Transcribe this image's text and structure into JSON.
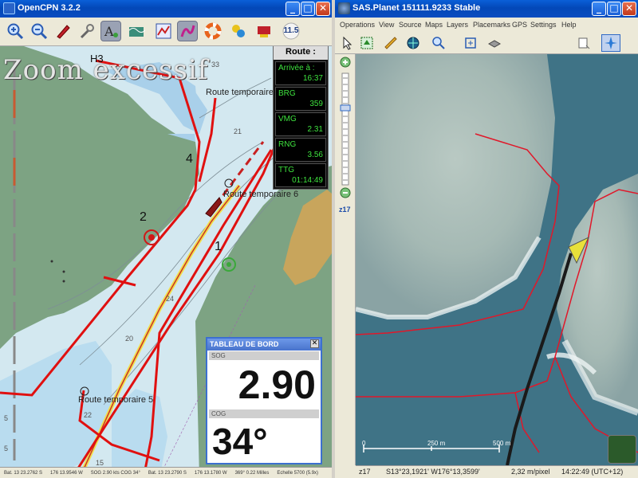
{
  "opencpn": {
    "title": "OpenCPN 3.2.2",
    "toolbar": {
      "tools": [
        "zoom-in",
        "zoom-out",
        "go-to-position",
        "settings",
        "text-anchor",
        "tide-current",
        "routes",
        "track",
        "lifebuoy",
        "plugin-chart",
        "ais",
        "scale"
      ],
      "scale_value": "11.5"
    },
    "chart": {
      "overzoom_text": "Zoom excessif",
      "route_labels": [
        "Route temporaire",
        "Route temporaire 6",
        "Route temporaire 5"
      ],
      "waypoint_numbers": [
        "1",
        "2",
        "4",
        "H3"
      ],
      "depths": [
        "33",
        "21",
        "24",
        "20",
        "22",
        "15",
        "5",
        "5"
      ]
    },
    "route_panel": {
      "title": "Route :",
      "fields": [
        {
          "label": "Arrivée à :",
          "value": "16:37"
        },
        {
          "label": "BRG",
          "value": "359"
        },
        {
          "label": "VMG",
          "value": "2.31"
        },
        {
          "label": "RNG",
          "value": "3.56"
        },
        {
          "label": "TTG",
          "value": "01:14:49"
        }
      ]
    },
    "dashboard": {
      "title": "TABLEAU DE BORD",
      "sog_label": "SOG",
      "sog_value": "2.90",
      "cog_label": "COG",
      "cog_value": "34°"
    },
    "status": [
      "Bat. 13 23.2762 S",
      "176 13.9546 W",
      "SOG 2.90 kts  COG 34°",
      "Bat. 13 23.2790 S",
      "176 13.1780 W",
      "369° 0.22 Milles",
      "Echelle 5700 (5.9x)"
    ]
  },
  "sasplanet": {
    "title": "SAS.Planet 151111.9233 Stable",
    "menu": [
      "Operations",
      "View",
      "Source",
      "Maps",
      "Layers",
      "Placemarks",
      "GPS",
      "Settings",
      "Help"
    ],
    "zoom_label": "z17",
    "scale": {
      "zero": "0",
      "mid": "250 m",
      "end": "500 m"
    },
    "status": {
      "zoom": "z17",
      "coords": "S13°23,1921' W176°13,3599'",
      "resolution": "2,32 m/pixel",
      "time": "14:22:49 (UTC+12)"
    }
  },
  "colors": {
    "route": "#e01010",
    "land": "#7da383",
    "shallow": "#a9d0ea",
    "water": "#d3e8f0",
    "xp_title": "#0a4cc0"
  }
}
